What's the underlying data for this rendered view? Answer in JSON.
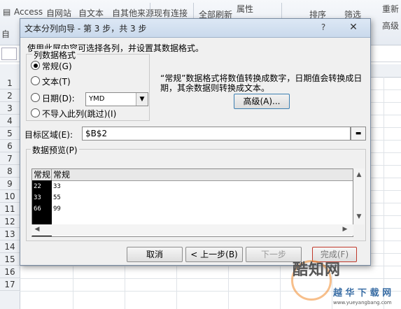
{
  "ribbon": {
    "access": "Access",
    "from_web": "自网站",
    "from_text": "自文本",
    "from_other": "自其他来源",
    "existing_connections": "现有连接",
    "refresh_all": "全部刷新",
    "properties": "属性",
    "sort": "排序",
    "filter": "筛选",
    "reapply": "重新",
    "advanced": "高级",
    "get_external": "自"
  },
  "rows": [
    "1",
    "2",
    "3",
    "4",
    "5",
    "6",
    "7",
    "8",
    "9",
    "10",
    "11",
    "12",
    "13",
    "14",
    "15",
    "16",
    "17"
  ],
  "dialog": {
    "title": "文本分列向导 - 第 3 步，共 3 步",
    "help": "?",
    "close": "✕",
    "instruction": "使用此屏内容可选择各列，并设置其数据格式。",
    "format_group": "列数据格式",
    "radios": [
      {
        "label": "常规(G)",
        "checked": true
      },
      {
        "label": "文本(T)",
        "checked": false
      },
      {
        "label": "日期(D):",
        "checked": false
      },
      {
        "label": "不导入此列(跳过)(I)",
        "checked": false
      }
    ],
    "date_value": "YMD",
    "description": "“常规”数据格式将数值转换成数字，日期值会转换成日期，其余数据则转换成文本。",
    "advanced_button": "高级(A)...",
    "destination_label": "目标区域(E):",
    "destination_value": "$B$2",
    "preview_group": "数据预览(P)",
    "preview_headers": [
      "常规",
      "常规"
    ],
    "preview_rows": [
      [
        "22",
        "33"
      ],
      [
        "33",
        "55"
      ],
      [
        "66",
        "99"
      ]
    ],
    "buttons": {
      "cancel": "取消",
      "back": "< 上一步(B)",
      "next": "下一步",
      "finish": "完成(F)"
    }
  },
  "watermark": {
    "logo": "酷知网",
    "sub": "越 华 下 载 网",
    "url": "www.yueyangbang.com"
  },
  "colors": {
    "dialog_bg": "#f0f0f0",
    "title_bar": "#c9d9ec",
    "finish_border": "#c0392b"
  }
}
